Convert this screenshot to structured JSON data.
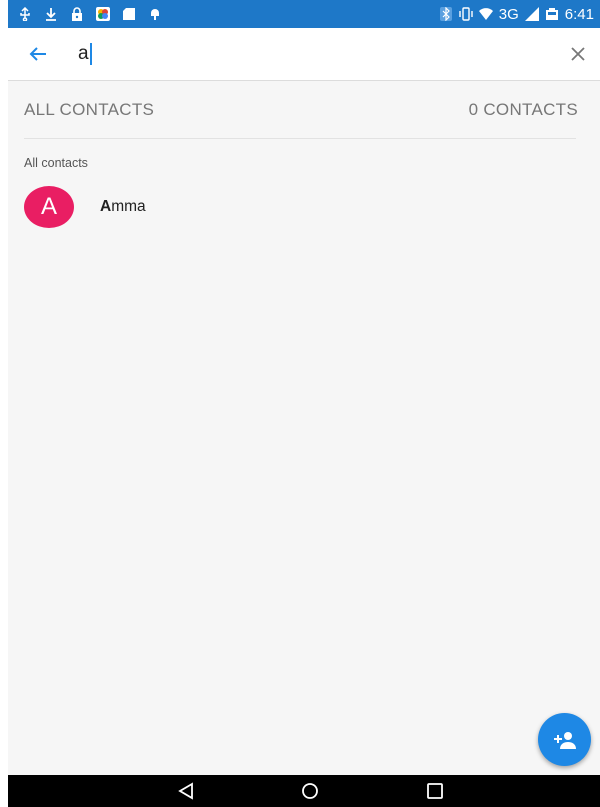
{
  "status_bar": {
    "time": "6:41",
    "network": "3G",
    "left_icons": [
      "usb-icon",
      "download-icon",
      "lock-icon",
      "photos-icon",
      "sd-card-icon",
      "android-debug-icon"
    ],
    "right_icons": [
      "bluetooth-icon",
      "vibrate-icon",
      "wifi-icon",
      "signal-icon",
      "battery-icon"
    ]
  },
  "search": {
    "query": "a"
  },
  "header": {
    "left": "ALL CONTACTS",
    "right": "0 CONTACTS"
  },
  "section_label": "All contacts",
  "contacts": [
    {
      "initial": "A",
      "name_match": "A",
      "name_rest": "mma",
      "avatar_color": "#e91e63"
    }
  ],
  "colors": {
    "status_bar": "#1e78c8",
    "accent": "#1e88e5",
    "avatar": "#e91e63"
  }
}
